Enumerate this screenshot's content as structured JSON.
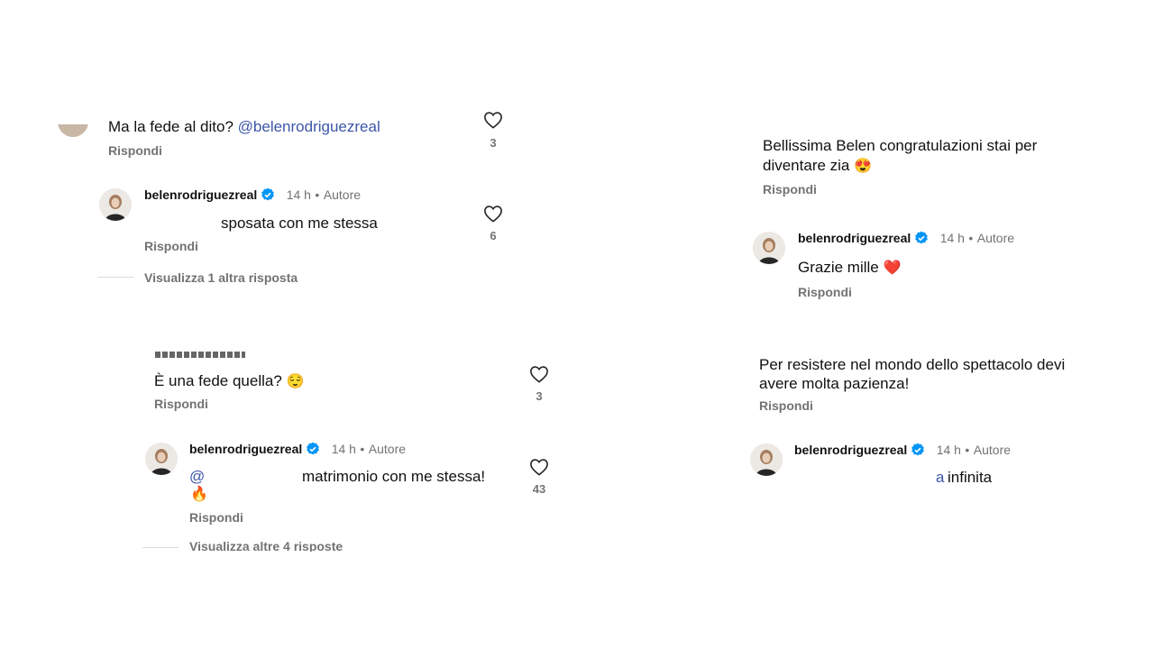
{
  "colors": {
    "mention": "#3c56a8",
    "verified": "#0095f6",
    "heart_red": "#e0292e"
  },
  "reply_label": "Rispondi",
  "panel1": {
    "comment": {
      "text": "Ma la fede al dito?",
      "mention": "@belenrodriguezreal",
      "likes": "3"
    },
    "reply": {
      "username": "belenrodriguezreal",
      "time": "14 h",
      "author": "Autore",
      "text": "sposata con me stessa",
      "likes": "6"
    },
    "view_more": "Visualizza 1 altra risposta"
  },
  "panel2": {
    "comment": {
      "text": "È una fede quella?",
      "emoji": "😌",
      "likes": "3"
    },
    "reply": {
      "username": "belenrodriguezreal",
      "time": "14 h",
      "author": "Autore",
      "mention_start": "@",
      "text": "matrimonio con me stessa!",
      "emoji": "🔥",
      "likes": "43"
    },
    "view_more": "Visualizza altre 4 risposte"
  },
  "panel3": {
    "comment": {
      "line1": "Bellissima Belen congratulazioni stai per",
      "line2": "diventare zia",
      "emoji": "😍"
    },
    "reply": {
      "username": "belenrodriguezreal",
      "time": "14 h",
      "author": "Autore",
      "text": "Grazie mille",
      "emoji": "❤️"
    }
  },
  "panel4": {
    "comment": {
      "line1": "Per resistere nel mondo dello spettacolo devi",
      "line2": "avere molta pazienza!"
    },
    "reply": {
      "username": "belenrodriguezreal",
      "time": "14 h",
      "author": "Autore",
      "mention_end": "a",
      "text": "infinita"
    }
  }
}
